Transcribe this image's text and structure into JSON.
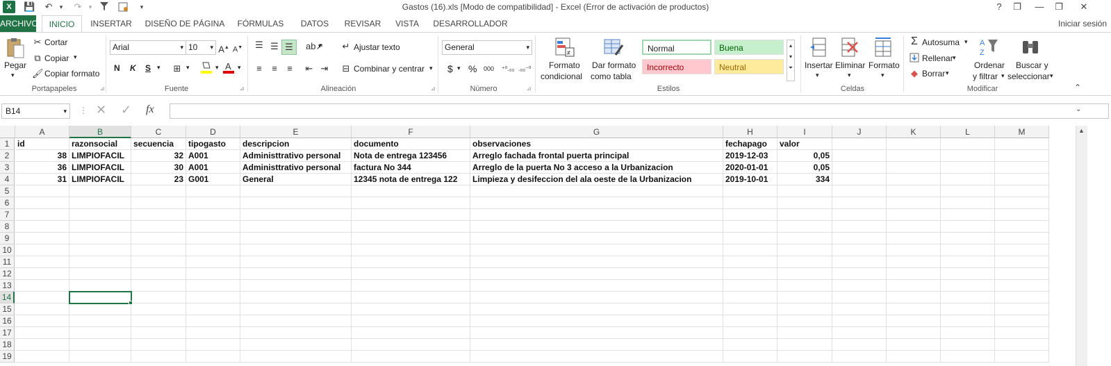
{
  "window": {
    "title": "Gastos (16).xls  [Modo de compatibilidad] - Excel (Error de activación de productos)",
    "help": "?",
    "restore": "❐",
    "minimize": "—",
    "maximize": "❐",
    "close": "✕"
  },
  "qat": {
    "logo": "X",
    "save": "💾",
    "undo": "↶",
    "redo": "↷",
    "filter": "⏷",
    "more": "▾"
  },
  "tabs": [
    {
      "label": "ARCHIVO"
    },
    {
      "label": "INICIO"
    },
    {
      "label": "INSERTAR"
    },
    {
      "label": "DISEÑO DE PÁGINA"
    },
    {
      "label": "FÓRMULAS"
    },
    {
      "label": "DATOS"
    },
    {
      "label": "REVISAR"
    },
    {
      "label": "VISTA"
    },
    {
      "label": "DESARROLLADOR"
    }
  ],
  "signin": "Iniciar sesión",
  "ribbon": {
    "clipboard": {
      "paste": "Pegar",
      "cut": "Cortar",
      "copy": "Copiar",
      "copy_format": "Copiar formato",
      "label": "Portapapeles"
    },
    "font": {
      "name": "Arial",
      "size": "10",
      "bold": "N",
      "italic": "K",
      "underline": "S",
      "label": "Fuente"
    },
    "alignment": {
      "wrap": "Ajustar texto",
      "merge": "Combinar y centrar",
      "label": "Alineación"
    },
    "number": {
      "format": "General",
      "currency": "$",
      "percent": "%",
      "thousands": "000",
      "label": "Número"
    },
    "styles": {
      "cond_format_1": "Formato",
      "cond_format_2": "condicional",
      "table_format_1": "Dar formato",
      "table_format_2": "como tabla",
      "normal": "Normal",
      "good": "Buena",
      "bad": "Incorrecto",
      "neutral": "Neutral",
      "label": "Estilos"
    },
    "cells": {
      "insert": "Insertar",
      "delete": "Eliminar",
      "format": "Formato",
      "label": "Celdas"
    },
    "editing": {
      "autosum": "Autosuma",
      "fill": "Rellenar",
      "clear": "Borrar",
      "sort_1": "Ordenar",
      "sort_2": "y filtrar",
      "find_1": "Buscar y",
      "find_2": "seleccionar",
      "label": "Modificar"
    }
  },
  "formula_bar": {
    "name_box": "B14",
    "fx": "fx",
    "value": ""
  },
  "sheet": {
    "columns": [
      "A",
      "B",
      "C",
      "D",
      "E",
      "F",
      "G",
      "H",
      "I",
      "J",
      "K",
      "L",
      "M"
    ],
    "rows": [
      "1",
      "2",
      "3",
      "4",
      "5",
      "6",
      "7",
      "8",
      "9",
      "10",
      "11",
      "12",
      "13",
      "14",
      "15",
      "16",
      "17",
      "18",
      "19"
    ],
    "header": [
      "id",
      "razonsocial",
      "secuencia",
      "tipogasto",
      "descripcion",
      "documento",
      "observaciones",
      "fechapago",
      "valor"
    ],
    "data": [
      [
        "38",
        "LIMPIOFACIL",
        "32",
        "A001",
        "Administtrativo personal",
        "Nota de entrega 123456",
        "Arreglo fachada frontal puerta principal",
        "2019-12-03",
        "0,05"
      ],
      [
        "36",
        "LIMPIOFACIL",
        "30",
        "A001",
        "Administtrativo personal",
        "factura No 344",
        "Arreglo de la puerta  No 3 acceso a la Urbanizacion",
        "2020-01-01",
        "0,05"
      ],
      [
        "31",
        "LIMPIOFACIL",
        "23",
        "G001",
        "General",
        "12345 nota de entrega 122",
        "Limpieza y desifeccion del ala oeste de la Urbanizacion",
        "2019-10-01",
        "334"
      ]
    ],
    "active_cell": "B14"
  }
}
